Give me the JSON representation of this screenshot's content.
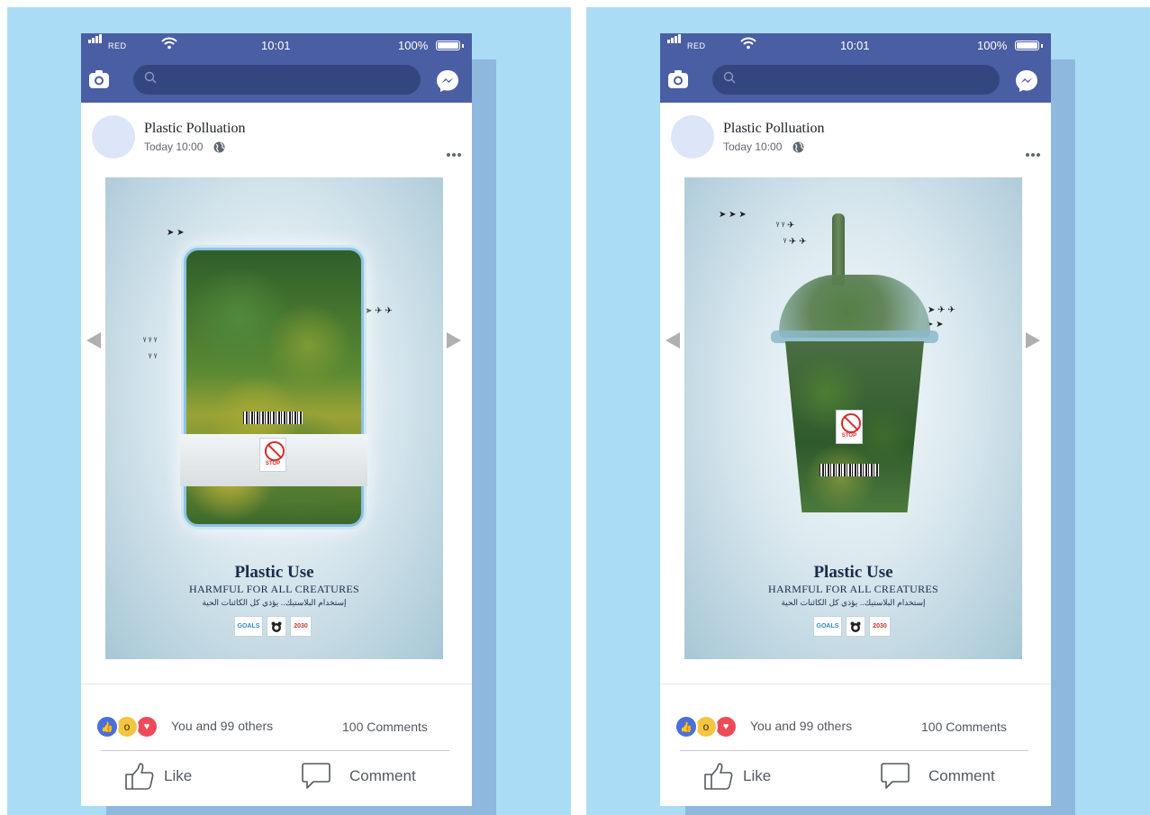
{
  "status_bar": {
    "carrier": "RED",
    "time": "10:01",
    "battery": "100%"
  },
  "nav": {
    "search_placeholder": ""
  },
  "posts": [
    {
      "author": "Plastic Polluation",
      "time": "Today 10:00",
      "image": {
        "title": "Plastic Use",
        "subtitle": "HARMFUL FOR ALL CREATURES",
        "arabic": "إستخدام البلاستيك.. يؤذي كل الكائنات الحية",
        "stop_label": "STOP",
        "logo_sdg": "GOALS",
        "logo_2030": "2030"
      },
      "reactions_text": "You and 99 others",
      "comments_text": "100 Comments",
      "like_label": "Like",
      "comment_label": "Comment"
    },
    {
      "author": "Plastic Polluation",
      "time": "Today 10:00",
      "image": {
        "title": "Plastic Use",
        "subtitle": "HARMFUL FOR ALL CREATURES",
        "arabic": "إستخدام البلاستيك.. يؤذي كل الكائنات الحية",
        "stop_label": "STOP",
        "logo_sdg": "GOALS",
        "logo_2030": "2030"
      },
      "reactions_text": "You and 99 others",
      "comments_text": "100 Comments",
      "like_label": "Like",
      "comment_label": "Comment"
    }
  ],
  "colors": {
    "background": "#abdcf6",
    "shadow": "#8fb8de",
    "facebook_bar": "#4a5ea3",
    "search_field": "#33467f"
  },
  "icons": [
    "signal-icon",
    "wifi-icon",
    "battery-icon",
    "camera-icon",
    "search-icon",
    "messenger-icon",
    "globe-icon",
    "more-icon",
    "prev-arrow-icon",
    "next-arrow-icon",
    "like-reaction-icon",
    "wow-reaction-icon",
    "love-reaction-icon",
    "thumbs-up-icon",
    "comment-icon"
  ]
}
